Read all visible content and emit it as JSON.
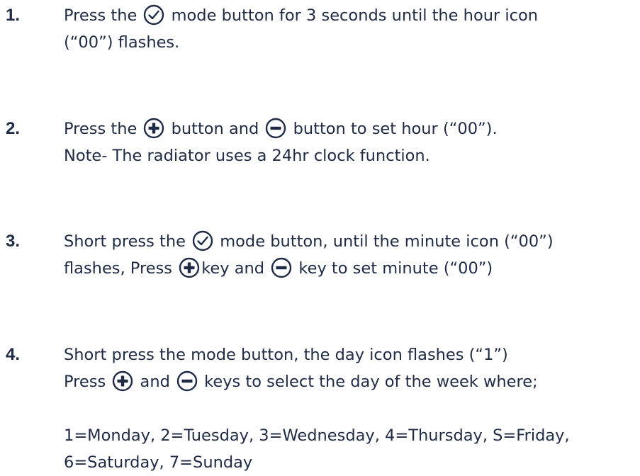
{
  "steps": [
    {
      "number": "1.",
      "lines": [
        [
          "Press the ",
          {
            "icon": "check-circle-icon"
          },
          " mode button for 3 seconds until the hour icon"
        ],
        [
          "(“00”) flashes."
        ]
      ]
    },
    {
      "number": "2.",
      "lines": [
        [
          "Press the ",
          {
            "icon": "plus-circle-icon"
          },
          " button and ",
          {
            "icon": "minus-circle-icon"
          },
          " button to set hour (“00”)."
        ],
        [
          "Note- The radiator uses a 24hr clock function."
        ]
      ]
    },
    {
      "number": "3.",
      "lines": [
        [
          "Short press the ",
          {
            "icon": "check-circle-icon"
          },
          " mode button, until the minute icon (“00”)"
        ],
        [
          "flashes, Press ",
          {
            "icon": "plus-circle-icon"
          },
          "key and ",
          {
            "icon": "minus-circle-icon"
          },
          " key to set minute (“00”)"
        ]
      ]
    },
    {
      "number": "4.",
      "lines": [
        [
          "Short press the mode button, the day icon flashes (“1”)"
        ],
        [
          "Press ",
          {
            "icon": "plus-circle-icon"
          },
          " and ",
          {
            "icon": "minus-circle-icon"
          },
          " keys to select the day of the week where;"
        ],
        [
          ""
        ],
        [
          "1=Monday, 2=Tuesday, 3=Wednesday, 4=Thursday, S=Friday,"
        ],
        [
          "6=Saturday, 7=Sunday"
        ]
      ]
    }
  ]
}
